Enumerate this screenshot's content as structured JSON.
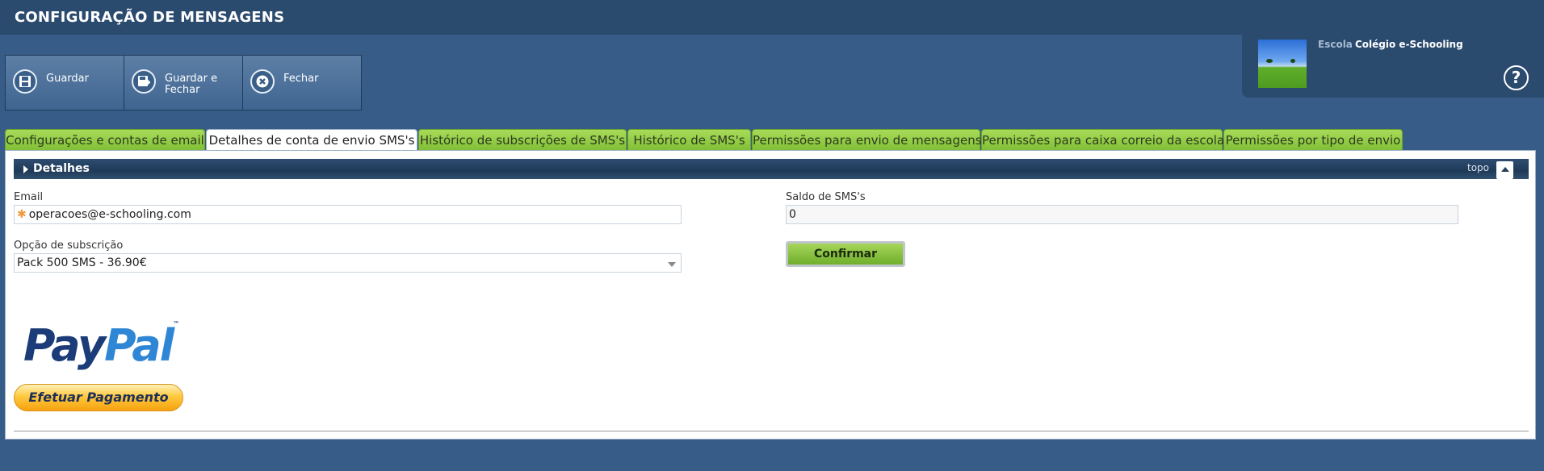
{
  "header": {
    "title": "CONFIGURAÇÃO DE MENSAGENS"
  },
  "toolbar": {
    "save_label": "Guardar",
    "save_close_label_line1": "Guardar e",
    "save_close_label_line2": "Fechar",
    "close_label": "Fechar"
  },
  "school": {
    "label": "Escola",
    "name": "Colégio e-Schooling"
  },
  "help": {
    "symbol": "?"
  },
  "tabs": [
    {
      "label": "Configurações e contas de email"
    },
    {
      "label": "Detalhes de conta de envio SMS's"
    },
    {
      "label": "Histórico de subscrições de SMS's"
    },
    {
      "label": "Histórico de SMS's"
    },
    {
      "label": "Permissões para envio de mensagens"
    },
    {
      "label": "Permissões para caixa correio da escola"
    },
    {
      "label": "Permissões por tipo de envio"
    }
  ],
  "active_tab": 1,
  "section": {
    "title": "Detalhes",
    "top_label": "topo"
  },
  "form": {
    "email_label": "Email",
    "email_value": "operacoes@e-schooling.com",
    "subscription_label": "Opção de subscrição",
    "subscription_value": "Pack 500 SMS - 36.90€",
    "balance_label": "Saldo de SMS's",
    "balance_value": "0",
    "confirm_label": "Confirmar"
  },
  "paypal": {
    "logo_part1": "Pay",
    "logo_part2": "Pal",
    "logo_tm": "™",
    "pay_button_label": "Efetuar Pagamento"
  },
  "colors": {
    "background": "#365c87",
    "header": "#2a4a6e",
    "tab_green": "#8ccc42",
    "confirm_green": "#7fbf34",
    "paypal_dark": "#1b3c78",
    "paypal_light": "#2f86d4",
    "pay_button": "#ffc93f"
  },
  "icons": [
    "save-icon",
    "save-close-icon",
    "close-icon",
    "help-icon",
    "collapse-triangle-icon",
    "scroll-top-icon",
    "dropdown-arrow-icon"
  ]
}
